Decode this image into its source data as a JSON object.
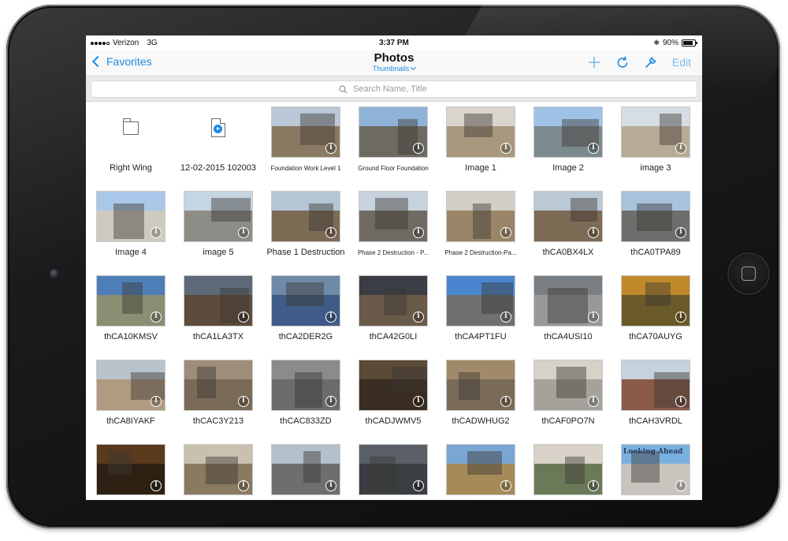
{
  "status_bar": {
    "carrier": "Verizon",
    "network": "3G",
    "time": "3:37 PM",
    "battery": "90%"
  },
  "nav": {
    "back_label": "Favorites",
    "title": "Photos",
    "view_mode": "Thumbnails",
    "edit_label": "Edit"
  },
  "search": {
    "placeholder": "Search Name, Title"
  },
  "colors": {
    "accent": "#1f8ae0",
    "edit_disabled": "#7fb9ea"
  },
  "items": [
    {
      "label": "Right Wing",
      "kind": "folder"
    },
    {
      "label": "12-02-2015 102003",
      "kind": "video"
    },
    {
      "label": "Foundation Work Level 1",
      "kind": "photo",
      "small": true
    },
    {
      "label": "Ground Floor Foundation",
      "kind": "photo",
      "small": true
    },
    {
      "label": "Image 1",
      "kind": "photo"
    },
    {
      "label": "Image 2",
      "kind": "photo"
    },
    {
      "label": "image 3",
      "kind": "photo"
    },
    {
      "label": "Image 4",
      "kind": "photo"
    },
    {
      "label": "image 5",
      "kind": "photo"
    },
    {
      "label": "Phase 1 Destruction",
      "kind": "photo"
    },
    {
      "label": "Phase 2 Destruction - P...",
      "kind": "photo",
      "small": true
    },
    {
      "label": "Phase 2 Destruction-Pa...",
      "kind": "photo",
      "small": true
    },
    {
      "label": "thCA0BX4LX",
      "kind": "photo"
    },
    {
      "label": "thCA0TPA89",
      "kind": "photo"
    },
    {
      "label": "thCA10KMSV",
      "kind": "photo"
    },
    {
      "label": "thCA1LA3TX",
      "kind": "photo"
    },
    {
      "label": "thCA2DER2G",
      "kind": "photo"
    },
    {
      "label": "thCA42G0LI",
      "kind": "photo"
    },
    {
      "label": "thCA4PT1FU",
      "kind": "photo"
    },
    {
      "label": "thCA4USI10",
      "kind": "photo"
    },
    {
      "label": "thCA70AUYG",
      "kind": "photo"
    },
    {
      "label": "thCA8IYAKF",
      "kind": "photo"
    },
    {
      "label": "thCAC3Y213",
      "kind": "photo"
    },
    {
      "label": "thCAC833ZD",
      "kind": "photo"
    },
    {
      "label": "thCADJWMV5",
      "kind": "photo"
    },
    {
      "label": "thCADWHUG2",
      "kind": "photo"
    },
    {
      "label": "thCAF0PO7N",
      "kind": "photo"
    },
    {
      "label": "thCAH3VRDL",
      "kind": "photo"
    },
    {
      "label": "",
      "kind": "photo"
    },
    {
      "label": "",
      "kind": "photo"
    },
    {
      "label": "",
      "kind": "photo"
    },
    {
      "label": "",
      "kind": "photo"
    },
    {
      "label": "",
      "kind": "photo"
    },
    {
      "label": "",
      "kind": "photo"
    },
    {
      "label": "Looking Ahead",
      "kind": "photo",
      "overlay_text": true
    }
  ]
}
